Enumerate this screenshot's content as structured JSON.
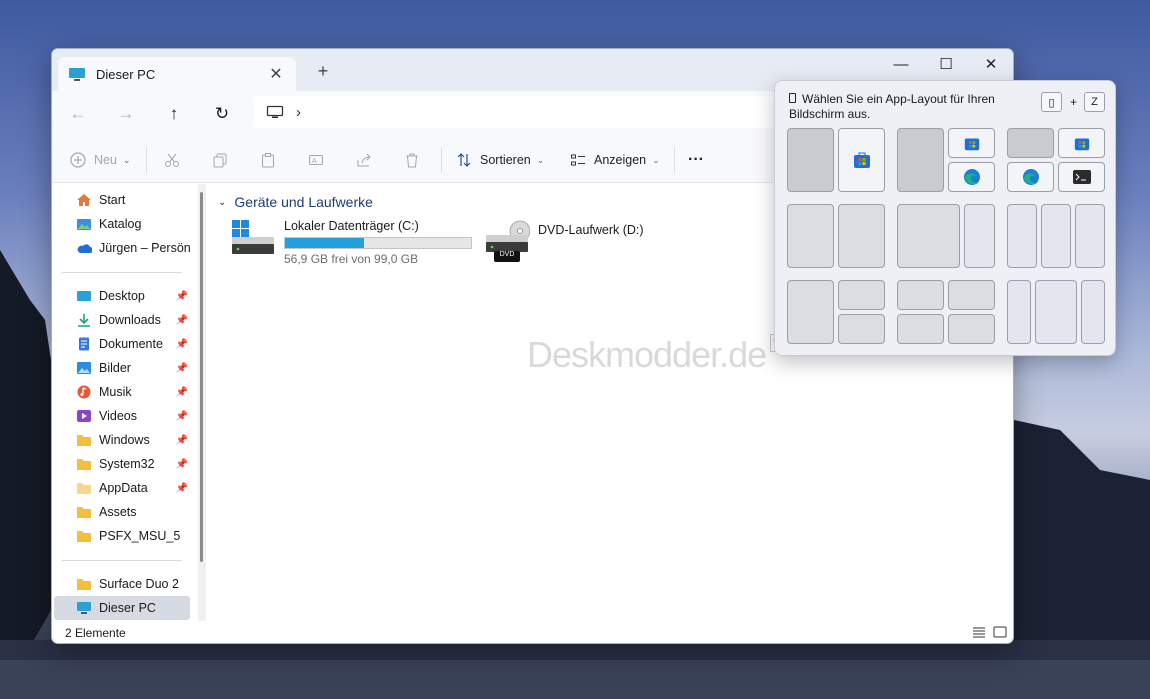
{
  "window": {
    "tab_title": "Dieser PC",
    "tab_close": "✕",
    "new_tab": "+",
    "minimize": "—",
    "maximize": "☐",
    "close": "✕"
  },
  "nav": {
    "back": "←",
    "forward": "→",
    "up": "↑",
    "refresh": "↻",
    "breadcrumb_sep": "›"
  },
  "toolbar": {
    "new_label": "Neu",
    "sort_label": "Sortieren",
    "view_label": "Anzeigen",
    "more": "···"
  },
  "sidebar": {
    "top": [
      {
        "label": "Start",
        "icon": "home-icon"
      },
      {
        "label": "Katalog",
        "icon": "gallery-icon"
      },
      {
        "label": "Jürgen – Persönlich",
        "icon": "onedrive-icon"
      }
    ],
    "quick": [
      {
        "label": "Desktop",
        "icon": "desktop-icon"
      },
      {
        "label": "Downloads",
        "icon": "download-icon"
      },
      {
        "label": "Dokumente",
        "icon": "document-icon"
      },
      {
        "label": "Bilder",
        "icon": "pictures-icon"
      },
      {
        "label": "Musik",
        "icon": "music-icon"
      },
      {
        "label": "Videos",
        "icon": "videos-icon"
      },
      {
        "label": "Windows",
        "icon": "folder-icon"
      },
      {
        "label": "System32",
        "icon": "folder-icon"
      },
      {
        "label": "AppData",
        "icon": "folder-icon"
      },
      {
        "label": "Assets",
        "icon": "folder-icon"
      },
      {
        "label": "PSFX_MSU_5",
        "icon": "folder-icon"
      }
    ],
    "bottom": [
      {
        "label": "Surface Duo 2",
        "icon": "folder-icon"
      },
      {
        "label": "Dieser PC",
        "icon": "pc-icon",
        "selected": true
      }
    ],
    "pin_glyph": "📌"
  },
  "content": {
    "section_title": "Geräte und Laufwerke",
    "section_chevron": "⌄",
    "drives": [
      {
        "name": "Lokaler Datenträger (C:)",
        "free_text": "56,9 GB frei von 99,0 GB",
        "used_fraction": 0.425
      },
      {
        "name": "DVD-Laufwerk (D:)",
        "badge": "DVD"
      }
    ],
    "watermark": "Deskmodder.de"
  },
  "status": {
    "item_count": "2 Elemente"
  },
  "snap": {
    "hint": "Wählen Sie ein App-Layout für Ihren Bildschirm aus.",
    "key_win": "▯",
    "key_plus": "+",
    "key_z": "Z"
  },
  "colors": {
    "accent": "#26a0da",
    "selection": "#d6dae2",
    "store_blue": "#1f6fd6",
    "edge_teal": "#1db38a"
  }
}
